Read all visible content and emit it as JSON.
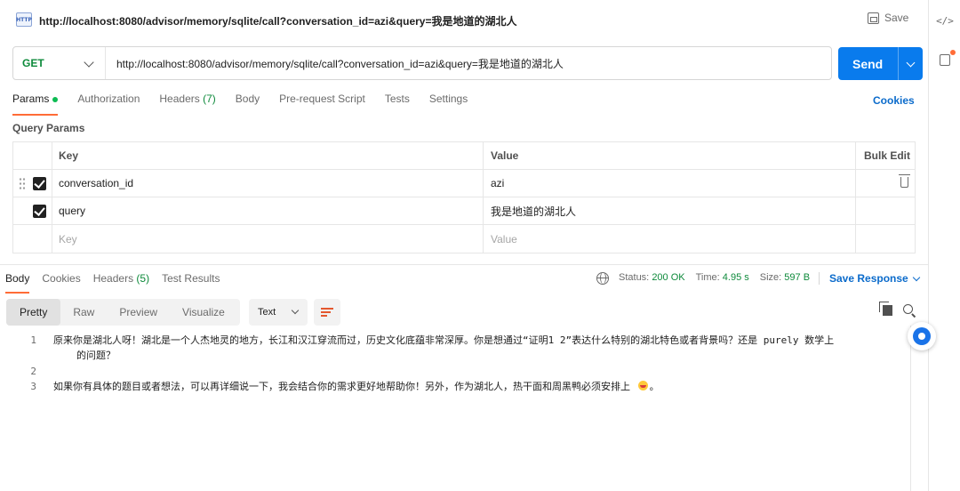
{
  "request": {
    "title": "http://localhost:8080/advisor/memory/sqlite/call?conversation_id=azi&query=我是地道的湖北人",
    "method": "GET",
    "url": "http://localhost:8080/advisor/memory/sqlite/call?conversation_id=azi&query=我是地道的湖北人",
    "save_label": "Save",
    "send_label": "Send",
    "badge": "HTTP"
  },
  "request_tabs": {
    "params": "Params",
    "authorization": "Authorization",
    "headers": "Headers",
    "headers_count": "(7)",
    "body": "Body",
    "prerequest": "Pre-request Script",
    "tests": "Tests",
    "settings": "Settings",
    "cookies": "Cookies"
  },
  "query_params": {
    "title": "Query Params",
    "header_key": "Key",
    "header_value": "Value",
    "bulk_edit": "Bulk Edit",
    "rows": [
      {
        "key": "conversation_id",
        "value": "azi",
        "checked": true
      },
      {
        "key": "query",
        "value": "我是地道的湖北人",
        "checked": true
      }
    ],
    "placeholder_key": "Key",
    "placeholder_value": "Value"
  },
  "response_tabs": {
    "body": "Body",
    "cookies": "Cookies",
    "headers": "Headers",
    "headers_count": "(5)",
    "test_results": "Test Results"
  },
  "response_meta": {
    "status_label": "Status:",
    "status_value": "200 OK",
    "time_label": "Time:",
    "time_value": "4.95 s",
    "size_label": "Size:",
    "size_value": "597 B",
    "save_response": "Save Response"
  },
  "format_toolbar": {
    "options": [
      "Pretty",
      "Raw",
      "Preview",
      "Visualize"
    ],
    "selected": "Pretty",
    "language": "Text"
  },
  "response_body": {
    "lines": [
      {
        "num": "1",
        "text": "原来你是湖北人呀！湖北是一个人杰地灵的地方，长江和汉江穿流而过，历史文化底蕴非常深厚。你是想通过“证明1 2”表达什么特别的湖北特色或者背景吗？还是 purely 数学上"
      },
      {
        "num": "",
        "text": "问题？",
        "prefix": "的"
      },
      {
        "num": "2",
        "text": ""
      },
      {
        "num": "3",
        "text": "如果你有具体的题目或者想法，可以再详细说一下，我会结合你的需求更好地帮助你！另外，作为湖北人，热干面和周黑鸭必须安排上",
        "suffix": "。"
      }
    ]
  },
  "right_rail": {
    "code_icon": "</>"
  },
  "colors": {
    "accent": "#ff6c37",
    "send": "#097bed",
    "method_get": "#0e8a3b",
    "link": "#0b6bcb"
  },
  "icons": [
    "http-icon",
    "save-icon",
    "chevron-down-icon",
    "drag-handle-icon",
    "checkbox-icon",
    "trash-icon",
    "globe-icon",
    "wrap-icon",
    "copy-icon",
    "search-icon",
    "code-icon",
    "info-panel-icon",
    "assistant-icon",
    "emoji-icon"
  ]
}
